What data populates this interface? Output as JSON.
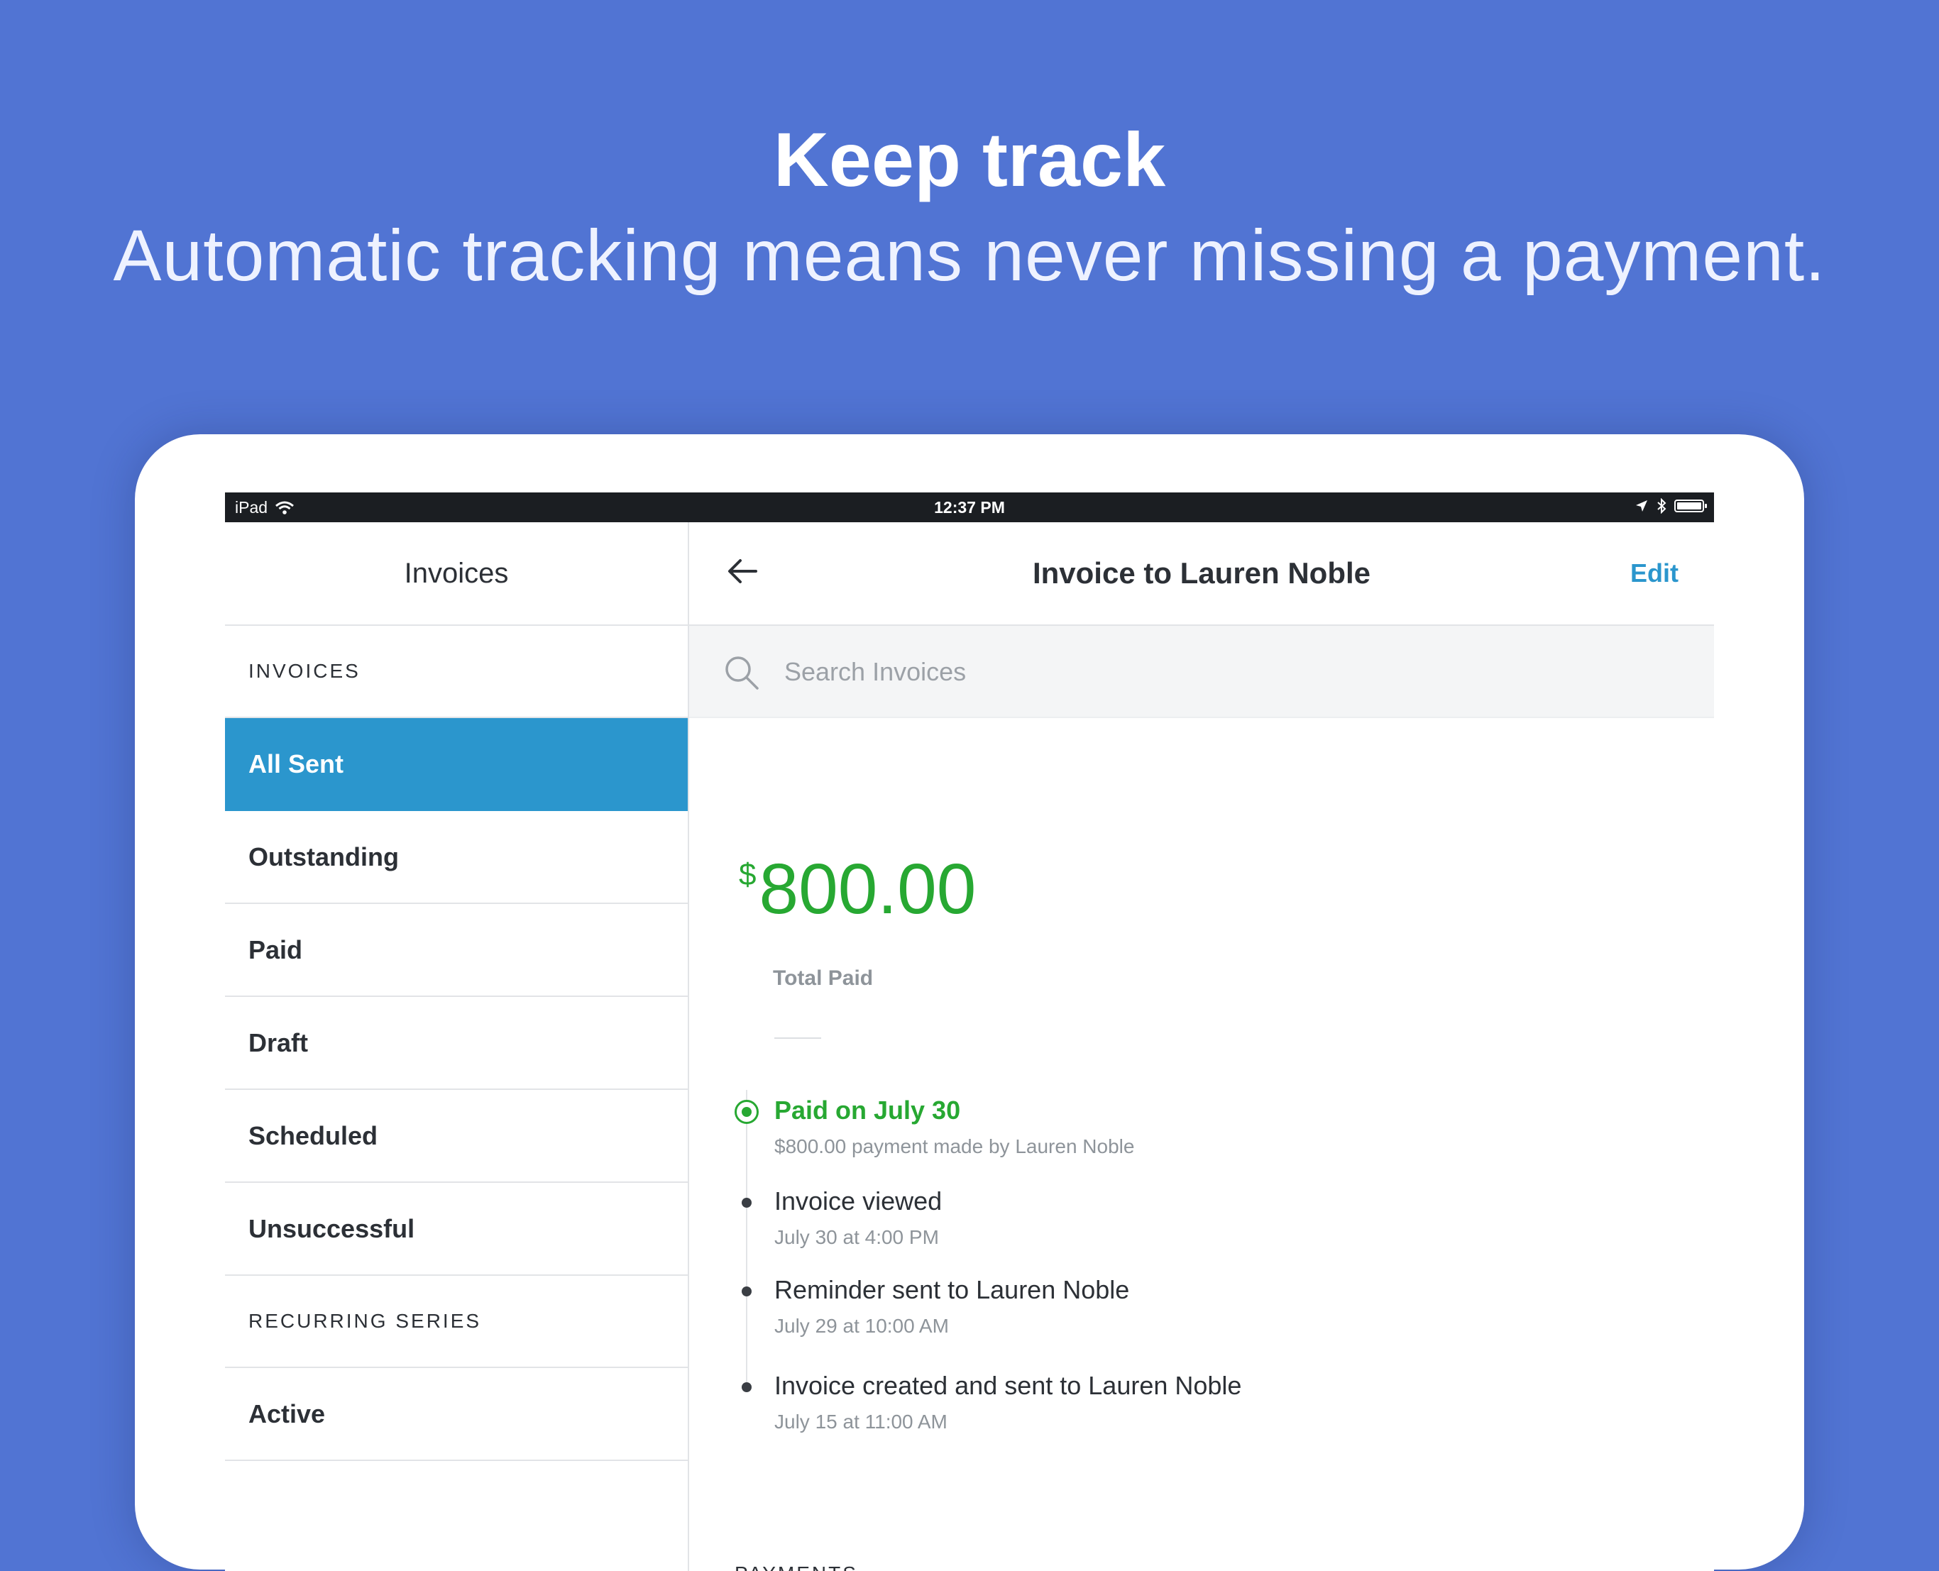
{
  "hero": {
    "title": "Keep track",
    "subtitle": "Automatic tracking means never missing a payment."
  },
  "status_bar": {
    "device": "iPad",
    "time": "12:37 PM"
  },
  "sidebar": {
    "title": "Invoices",
    "section_invoices": "INVOICES",
    "items": [
      {
        "label": "All Sent",
        "active": true
      },
      {
        "label": "Outstanding"
      },
      {
        "label": "Paid"
      },
      {
        "label": "Draft"
      },
      {
        "label": "Scheduled"
      },
      {
        "label": "Unsuccessful"
      }
    ],
    "section_recurring": "RECURRING SERIES",
    "recurring_items": [
      {
        "label": "Active"
      }
    ]
  },
  "detail": {
    "title": "Invoice to Lauren Noble",
    "edit_label": "Edit",
    "search_placeholder": "Search Invoices",
    "currency_symbol": "$",
    "amount": "800.00",
    "total_label": "Total Paid",
    "events": [
      {
        "title": "Paid on July 30",
        "subtitle": "$800.00 payment made by Lauren Noble",
        "status": "paid"
      },
      {
        "title": "Invoice viewed",
        "subtitle": "July 30 at 4:00 PM"
      },
      {
        "title": "Reminder sent to Lauren Noble",
        "subtitle": "July 29 at 10:00 AM"
      },
      {
        "title": "Invoice created and sent to Lauren Noble",
        "subtitle": "July 15 at 11:00 AM"
      }
    ],
    "payments_label": "PAYMENTS"
  },
  "colors": {
    "background": "#5174d3",
    "accent_blue": "#2b96cd",
    "paid_green": "#27a832",
    "text_dark": "#2c3036",
    "text_muted": "#8e949a"
  },
  "icons": [
    "wifi-icon",
    "location-arrow-icon",
    "bluetooth-icon",
    "battery-icon",
    "back-arrow-icon",
    "search-icon"
  ]
}
